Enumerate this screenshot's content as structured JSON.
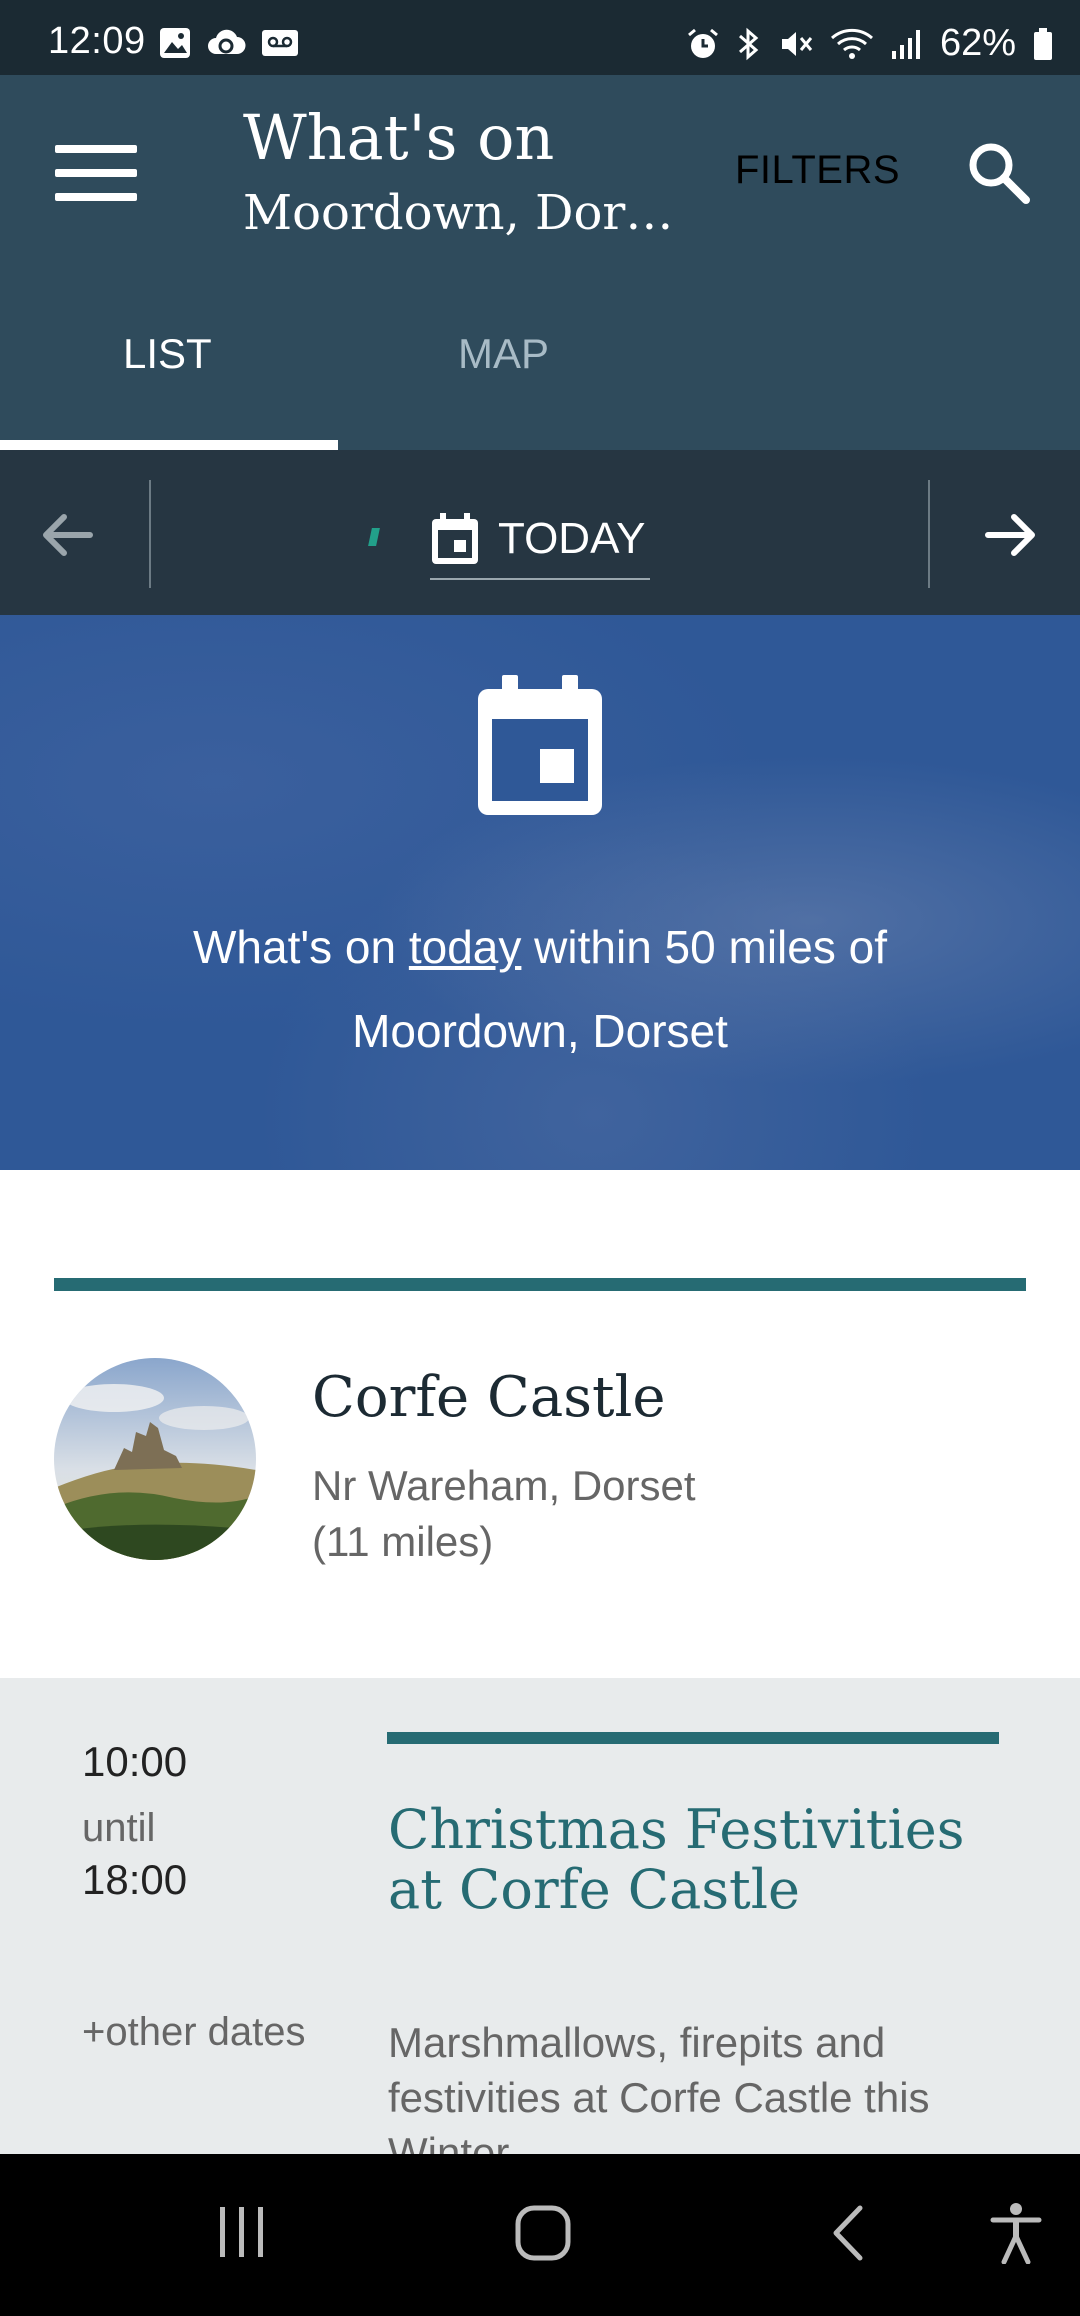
{
  "status_bar": {
    "time": "12:09",
    "battery": "62%"
  },
  "app_bar": {
    "title": "What's on",
    "subtitle": "Moordown, Dor…",
    "filters_label": "FILTERS"
  },
  "tabs": [
    {
      "label": "LIST",
      "selected": true
    },
    {
      "label": "MAP",
      "selected": false
    }
  ],
  "date_nav": {
    "label": "TODAY"
  },
  "hero": {
    "prefix": "What's on ",
    "linked_word": "today",
    "suffix": " within 50 miles of Moordown, Dorset"
  },
  "venue": {
    "name": "Corfe Castle",
    "location": "Nr Wareham, Dorset",
    "distance": "(11 miles)"
  },
  "event": {
    "start_time": "10:00",
    "until_label": "until",
    "end_time": "18:00",
    "title": "Christmas Festivities at Corfe Castle",
    "other_dates": "+other dates",
    "description": "Marshmallows, firepits and festivities at Corfe Castle this Winter"
  },
  "colors": {
    "app_bar": "#2f4b5c",
    "accent_teal": "#266b73",
    "hero_blue": "#2f5897"
  }
}
